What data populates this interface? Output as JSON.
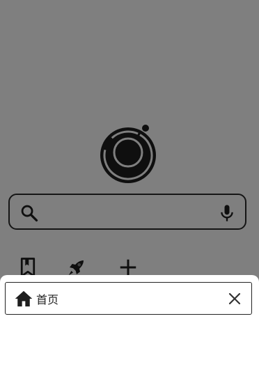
{
  "background_page": {
    "search": {
      "placeholder": ""
    },
    "shortcuts": [
      {
        "icon": "bookmark-icon"
      },
      {
        "icon": "rocket-icon"
      },
      {
        "icon": "plus-icon"
      }
    ]
  },
  "tab_sheet": {
    "tabs": [
      {
        "icon": "home-icon",
        "title": "首页"
      }
    ]
  },
  "colors": {
    "scrim": "#000000",
    "scrim_opacity": 0.5,
    "icon": "#1e1e1e",
    "border": "#222222"
  }
}
